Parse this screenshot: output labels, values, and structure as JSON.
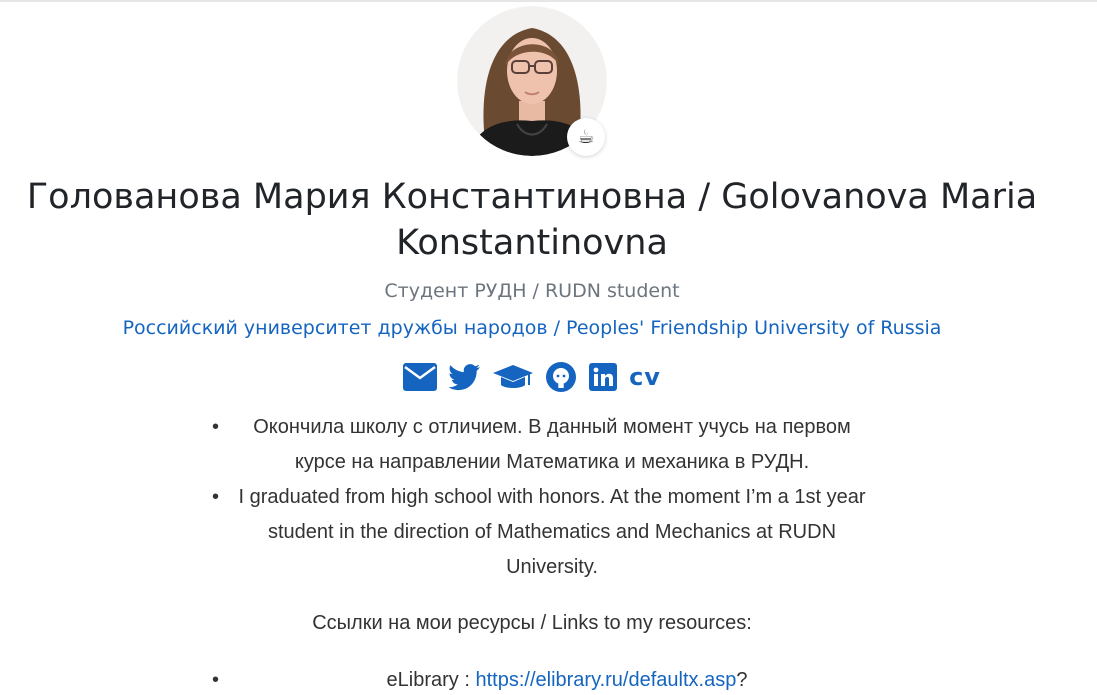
{
  "profile": {
    "name": "Голованова Мария Константиновна / Golovanova Maria Konstantinovna",
    "status_emoji": "☕",
    "role": "Студент РУДН / RUDN student",
    "organization": "Российский университет дружбы народов / Peoples' Friendship University of Russia"
  },
  "social": {
    "icons": [
      "envelope-icon",
      "twitter-icon",
      "graduation-cap-icon",
      "github-icon",
      "linkedin-icon"
    ],
    "cv_label": "cv",
    "color": "#1565c0"
  },
  "bio": {
    "items": [
      "Окончила школу с отличием. В данный момент учусь на первом курсе на направлении Математика и механика в РУДН.",
      "I graduated from high school with honors. At the moment I’m a 1st year student in the direction of Mathematics and Mechanics at RUDN University."
    ]
  },
  "resources": {
    "heading": "Ссылки на мои ресурсы / Links to my resources:",
    "items": [
      {
        "label": "eLibrary : ",
        "url_text": "https://elibrary.ru/defaultx.asp",
        "suffix": "?"
      }
    ]
  }
}
